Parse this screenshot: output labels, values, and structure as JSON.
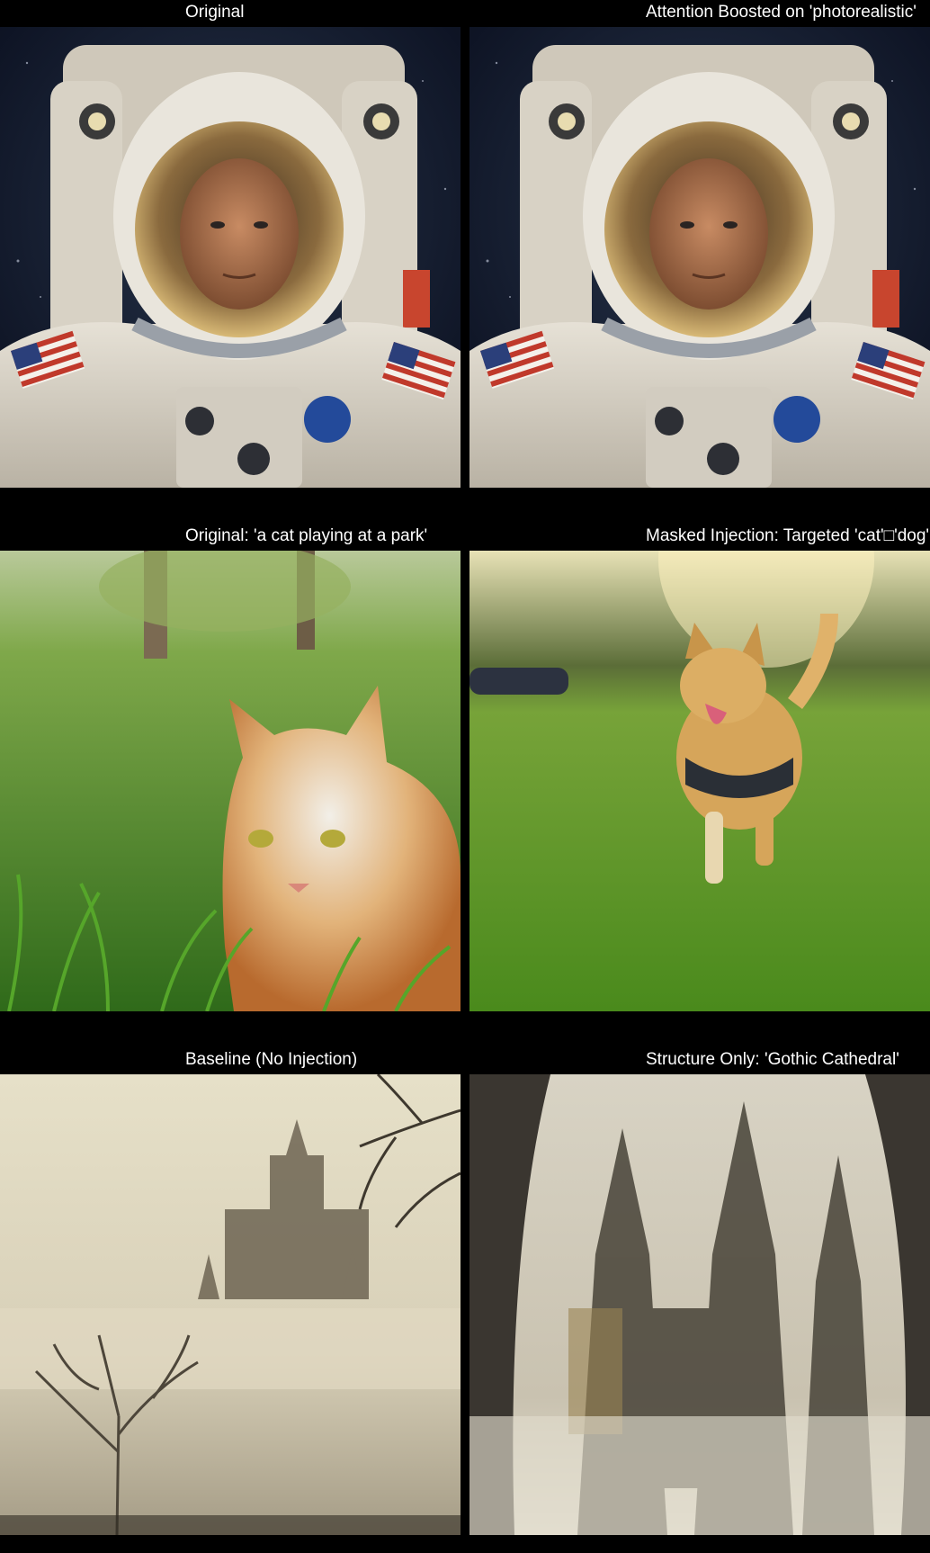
{
  "grid": {
    "rows": [
      {
        "left": {
          "title": "Original",
          "image": "astronaut portrait in white spacesuit with gold reflective visor and US flag patch, starry background"
        },
        "right": {
          "title": "Attention Boosted on 'photorealistic'",
          "image": "astronaut portrait in white spacesuit with gold reflective visor and US flag patch, starry background"
        }
      },
      {
        "left": {
          "title": "Original: 'a cat playing at a park'",
          "image": "orange and white tabby cat lying in bright green grass at a park"
        },
        "right": {
          "title": "Masked Injection: Targeted 'cat'□'dog'",
          "image": "golden dog with harness running across a sunny park lawn"
        }
      },
      {
        "left": {
          "title": "Baseline (No Injection)",
          "image": "misty sepia landscape with bare tree and distant castle spires"
        },
        "right": {
          "title": "Structure Only: 'Gothic Cathedral'",
          "image": "low-angle view of a foggy gothic cathedral with tall spires"
        }
      }
    ]
  },
  "colors": {
    "background": "#000000",
    "caption_text": "#ffffff"
  }
}
